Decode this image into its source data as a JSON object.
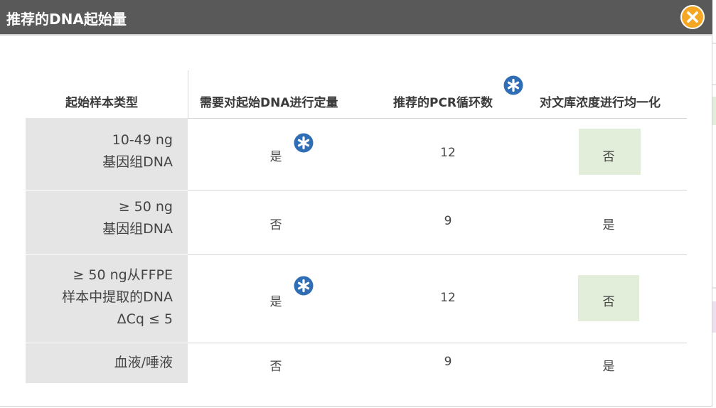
{
  "dialog": {
    "title": "推荐的DNA起始量",
    "close_icon": "close-icon",
    "accent_color": "#f5a623",
    "titlebar_color": "#595959"
  },
  "table": {
    "headers": [
      "起始样本类型",
      "需要对起始DNA进行定量",
      "推荐的PCR循环数",
      "对文库浓度进行均一化"
    ],
    "rows": [
      {
        "sample_lines": [
          "10-49 ng",
          "基因组DNA"
        ],
        "quantify": "是",
        "quantify_note": true,
        "cycles": "12",
        "normalize": "否",
        "normalize_highlight": true
      },
      {
        "sample_lines": [
          "≥ 50 ng",
          "基因组DNA"
        ],
        "quantify": "否",
        "quantify_note": false,
        "cycles": "9",
        "normalize": "是",
        "normalize_highlight": false
      },
      {
        "sample_lines": [
          "≥ 50 ng从FFPE",
          "样本中提取的DNA",
          "ΔCq ≤ 5"
        ],
        "quantify": "是",
        "quantify_note": true,
        "cycles": "12",
        "normalize": "否",
        "normalize_highlight": true
      },
      {
        "sample_lines": [
          "血液/唾液"
        ],
        "quantify": "否",
        "quantify_note": false,
        "cycles": "9",
        "normalize": "是",
        "normalize_highlight": false
      }
    ],
    "note_icon": "asterisk-icon",
    "note_icon_color": "#2f6db5",
    "highlight_color": "#e2eed9"
  }
}
